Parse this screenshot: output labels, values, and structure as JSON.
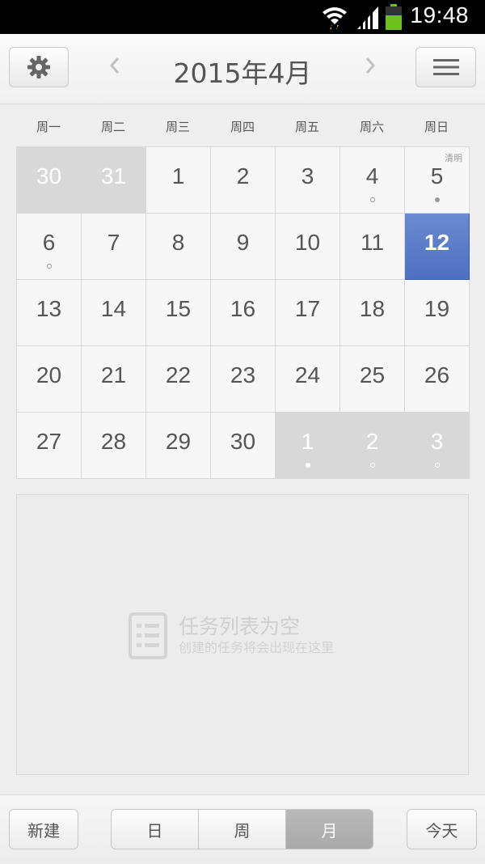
{
  "status_bar": {
    "time": "19:48",
    "colors": {
      "battery": "#6dc01e",
      "wifi_arrows": "#e6a200"
    }
  },
  "header": {
    "title": "2015年4月",
    "prev_icon": "chevron-left-icon",
    "next_icon": "chevron-right-icon",
    "settings_icon": "gear-icon",
    "menu_icon": "hamburger-menu-icon"
  },
  "weekdays": [
    "周一",
    "周二",
    "周三",
    "周四",
    "周五",
    "周六",
    "周日"
  ],
  "calendar": {
    "today": "12",
    "accent": "#5a78c6",
    "cells": [
      {
        "day": "30",
        "other": true,
        "dot": ""
      },
      {
        "day": "31",
        "other": true,
        "dot": ""
      },
      {
        "day": "1",
        "other": false,
        "dot": ""
      },
      {
        "day": "2",
        "other": false,
        "dot": ""
      },
      {
        "day": "3",
        "other": false,
        "dot": ""
      },
      {
        "day": "4",
        "other": false,
        "dot": "hollow"
      },
      {
        "day": "5",
        "other": false,
        "dot": "filled",
        "tag": "清明"
      },
      {
        "day": "6",
        "other": false,
        "dot": "hollow"
      },
      {
        "day": "7",
        "other": false,
        "dot": ""
      },
      {
        "day": "8",
        "other": false,
        "dot": ""
      },
      {
        "day": "9",
        "other": false,
        "dot": ""
      },
      {
        "day": "10",
        "other": false,
        "dot": ""
      },
      {
        "day": "11",
        "other": false,
        "dot": ""
      },
      {
        "day": "12",
        "other": false,
        "dot": "",
        "today": true
      },
      {
        "day": "13",
        "other": false,
        "dot": ""
      },
      {
        "day": "14",
        "other": false,
        "dot": ""
      },
      {
        "day": "15",
        "other": false,
        "dot": ""
      },
      {
        "day": "16",
        "other": false,
        "dot": ""
      },
      {
        "day": "17",
        "other": false,
        "dot": ""
      },
      {
        "day": "18",
        "other": false,
        "dot": ""
      },
      {
        "day": "19",
        "other": false,
        "dot": ""
      },
      {
        "day": "20",
        "other": false,
        "dot": ""
      },
      {
        "day": "21",
        "other": false,
        "dot": ""
      },
      {
        "day": "22",
        "other": false,
        "dot": ""
      },
      {
        "day": "23",
        "other": false,
        "dot": ""
      },
      {
        "day": "24",
        "other": false,
        "dot": ""
      },
      {
        "day": "25",
        "other": false,
        "dot": ""
      },
      {
        "day": "26",
        "other": false,
        "dot": ""
      },
      {
        "day": "27",
        "other": false,
        "dot": ""
      },
      {
        "day": "28",
        "other": false,
        "dot": ""
      },
      {
        "day": "29",
        "other": false,
        "dot": ""
      },
      {
        "day": "30",
        "other": false,
        "dot": ""
      },
      {
        "day": "1",
        "other": true,
        "dot": "filled"
      },
      {
        "day": "2",
        "other": true,
        "dot": "hollow"
      },
      {
        "day": "3",
        "other": true,
        "dot": "hollow"
      }
    ]
  },
  "task_panel": {
    "empty_title": "任务列表为空",
    "empty_subtitle": "创建的任务将会出现在这里",
    "icon": "task-list-icon"
  },
  "bottom_bar": {
    "new_label": "新建",
    "view_options": [
      "日",
      "周",
      "月"
    ],
    "active_view": "月",
    "today_label": "今天"
  }
}
